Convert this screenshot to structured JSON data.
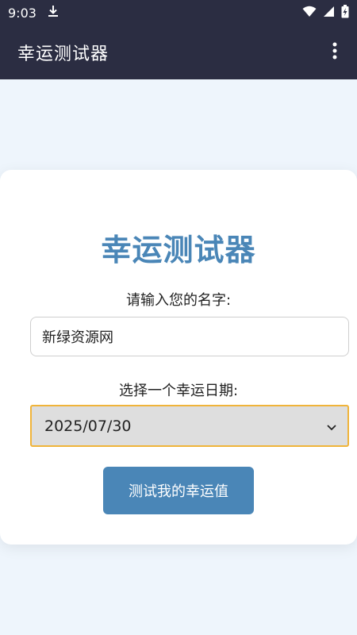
{
  "status_bar": {
    "time": "9:03",
    "icons": [
      "download-icon",
      "wifi-icon",
      "signal-icon",
      "battery-charging-icon"
    ]
  },
  "app_bar": {
    "title": "幸运测试器",
    "menu_icon": "more-vert-icon"
  },
  "card": {
    "title": "幸运测试器",
    "name_label": "请输入您的名字:",
    "name_value": "新绿资源网",
    "date_label": "选择一个幸运日期:",
    "date_value": "2025/07/30",
    "button_label": "测试我的幸运值"
  },
  "colors": {
    "bar_bg": "#2b2d42",
    "page_bg": "#eef5fc",
    "accent": "#4a86b7",
    "select_border": "#f0b43a"
  }
}
